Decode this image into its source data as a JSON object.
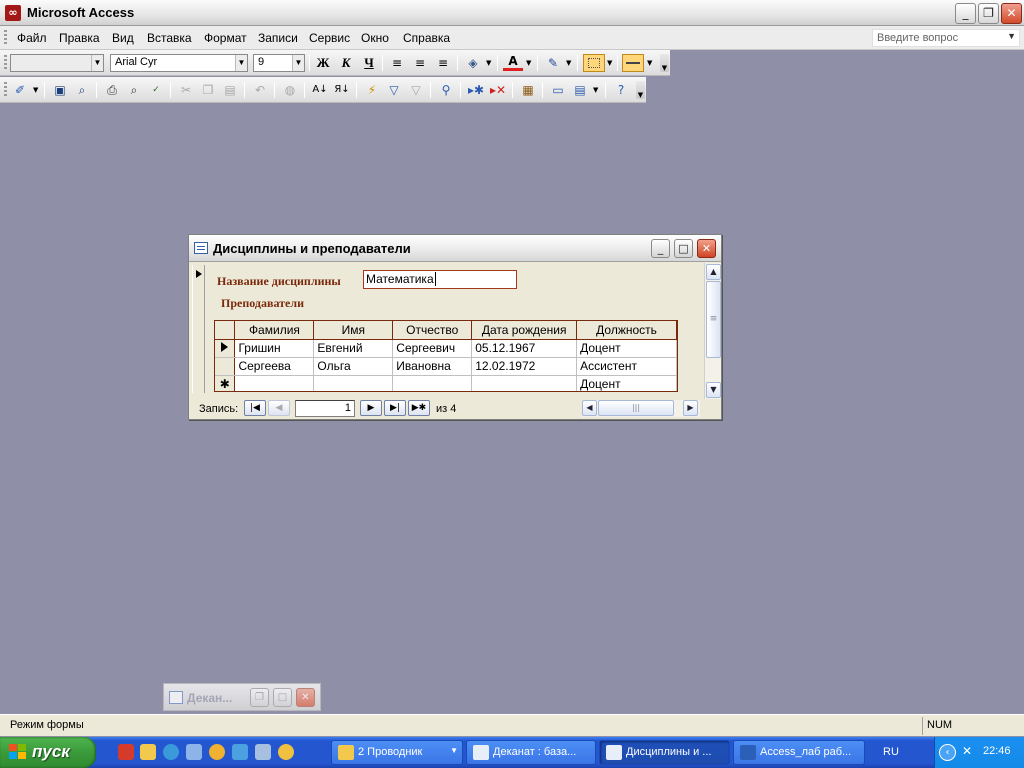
{
  "app": {
    "title": "Microsoft Access",
    "window_buttons": {
      "minimize": "_",
      "restore": "❐",
      "close": "✕"
    }
  },
  "menu": {
    "items": [
      {
        "label": "Файл"
      },
      {
        "label": "Правка"
      },
      {
        "label": "Вид"
      },
      {
        "label": "Вставка"
      },
      {
        "label": "Формат"
      },
      {
        "label": "Записи"
      },
      {
        "label": "Сервис"
      },
      {
        "label": "Окно"
      },
      {
        "label": "Справка"
      }
    ],
    "ask_placeholder": "Введите вопрос"
  },
  "format_toolbar": {
    "object_combo": "",
    "font_name": "Arial Cyr",
    "font_size": "9",
    "bold": "Ж",
    "italic": "К",
    "underline": "Ч"
  },
  "form_window": {
    "title": "Дисциплины и преподаватели",
    "discipline_label": "Название дисциплины",
    "discipline_value": "Математика",
    "teachers_label": "Преподаватели",
    "subform": {
      "columns": [
        "Фамилия",
        "Имя",
        "Отчество",
        "Дата рождения",
        "Должность"
      ],
      "rows": [
        {
          "cells": [
            "Гришин",
            "Евгений",
            "Сергеевич",
            "05.12.1967",
            "Доцент"
          ],
          "current": true
        },
        {
          "cells": [
            "Сергеева",
            "Ольга",
            "Ивановна",
            "12.02.1972",
            "Ассистент"
          ],
          "current": false
        },
        {
          "cells": [
            "",
            "",
            "",
            "",
            "Доцент"
          ],
          "new": true
        }
      ],
      "new_record_marker": "✱"
    },
    "navigation": {
      "label": "Запись:",
      "current_record": "1",
      "of_text": "из  4"
    }
  },
  "minimized_window": {
    "title": "Декан..."
  },
  "status_bar": {
    "text": "Режим формы",
    "num": "NUM"
  },
  "taskbar": {
    "start_label": "пуск",
    "tasks": [
      {
        "label": "2 Проводник",
        "icon_color": "#f2c94c",
        "active": false,
        "dropdown": true
      },
      {
        "label": "Деканат : база...",
        "icon_color": "#e8eef8",
        "active": false,
        "dropdown": false
      },
      {
        "label": "Дисциплины и ...",
        "icon_color": "#e8eef8",
        "active": true,
        "dropdown": false
      },
      {
        "label": "Access_лаб раб...",
        "icon_color": "#2b5fb8",
        "active": false,
        "dropdown": false
      }
    ],
    "language": "RU",
    "clock": "22:46"
  }
}
